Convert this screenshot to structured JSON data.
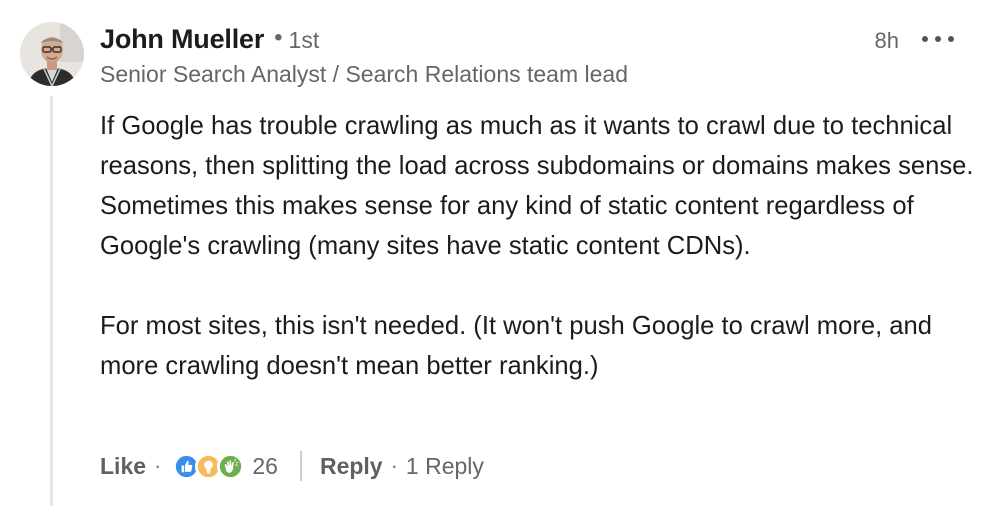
{
  "author": {
    "name": "John Mueller",
    "separator": "•",
    "degree": "1st",
    "headline": "Senior Search Analyst / Search Relations team lead"
  },
  "timestamp": "8h",
  "comment": {
    "paragraph1": "If Google has trouble crawling as much as it wants to crawl due to technical reasons, then splitting the load across subdomains or domains makes sense. Sometimes this makes sense for any kind of static content regardless of Google's crawling (many sites have static content CDNs).",
    "paragraph2": "For most sites, this isn't needed. (It won't push Google to crawl more, and more crawling doesn't mean better ranking.)"
  },
  "actions": {
    "like_label": "Like",
    "sep": "·",
    "reaction_count": "26",
    "reactions": [
      "like-icon",
      "insightful-icon",
      "celebrate-icon"
    ],
    "reply_label": "Reply",
    "reply_count": "1 Reply"
  },
  "colors": {
    "like": "#378fe9",
    "insightful": "#f5bb5c",
    "celebrate": "#6dae4f",
    "thread_line": "#e6e6e6"
  }
}
